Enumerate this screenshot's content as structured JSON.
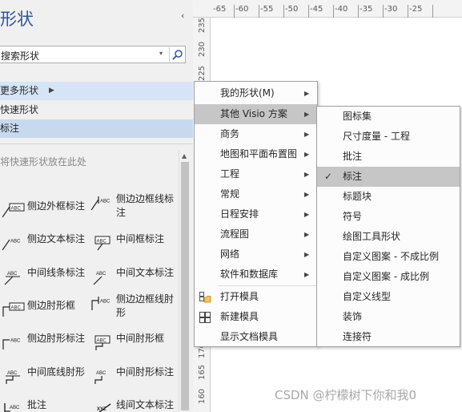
{
  "pane": {
    "title": "形状",
    "collapse_icon": "‹",
    "search_value": "搜索形状",
    "search_dropdown_icon": "▾",
    "more_shapes": "更多形状",
    "more_shapes_arrow": "▶",
    "quick_shapes": "快速形状",
    "current_stencil": "标注",
    "drop_hint": "将快速形状放在此处",
    "scroll_up_icon": "▲",
    "stencil_items": [
      {
        "label": "侧边外框标注"
      },
      {
        "label": "侧边边框线标注"
      },
      {
        "label": "侧边文本标注"
      },
      {
        "label": "中间框标注"
      },
      {
        "label": "中间线条标注"
      },
      {
        "label": "中间文本标注"
      },
      {
        "label": "侧边肘形框"
      },
      {
        "label": "侧边边框线肘形"
      },
      {
        "label": "侧边肘形标注"
      },
      {
        "label": "中间肘形框"
      },
      {
        "label": "中间底线肘形"
      },
      {
        "label": "中间肘形标注"
      },
      {
        "label": "批注"
      },
      {
        "label": "线间文本标注"
      }
    ],
    "icon_texts": {
      "abc": "ABC",
      "xyz": "XYZ"
    }
  },
  "ruler": {
    "top_labels": [
      "-65",
      "-60",
      "-55",
      "-50",
      "-45",
      "-40",
      "-35",
      "-30",
      "-25"
    ],
    "side_labels": [
      "235",
      "230",
      "225",
      "170",
      "165",
      "160"
    ]
  },
  "menu_primary": {
    "items": [
      {
        "label": "我的形状(M)",
        "has_submenu": true
      },
      {
        "label": "其他 Visio 方案",
        "has_submenu": true,
        "selected": true
      },
      {
        "label": "商务",
        "has_submenu": true
      },
      {
        "label": "地图和平面布置图",
        "has_submenu": true
      },
      {
        "label": "工程",
        "has_submenu": true
      },
      {
        "label": "常规",
        "has_submenu": true
      },
      {
        "label": "日程安排",
        "has_submenu": true
      },
      {
        "label": "流程图",
        "has_submenu": true
      },
      {
        "label": "网络",
        "has_submenu": true
      },
      {
        "label": "软件和数据库",
        "has_submenu": true
      }
    ],
    "actions": [
      {
        "label": "打开模具",
        "icon": "open-stencil-icon"
      },
      {
        "label": "新建模具",
        "icon": "new-stencil-icon"
      },
      {
        "label": "显示文档模具",
        "icon": ""
      }
    ],
    "arrow_glyph": "▶"
  },
  "menu_secondary": {
    "items": [
      {
        "label": "图标集"
      },
      {
        "label": "尺寸度量 - 工程"
      },
      {
        "label": "批注"
      },
      {
        "label": "标注",
        "checked": true
      },
      {
        "label": "标题块"
      },
      {
        "label": "符号"
      },
      {
        "label": "绘图工具形状"
      },
      {
        "label": "自定义图案 - 不成比例"
      },
      {
        "label": "自定义图案 - 成比例"
      },
      {
        "label": "自定义线型"
      },
      {
        "label": "装饰"
      },
      {
        "label": "连接符"
      }
    ],
    "check_glyph": "✓"
  },
  "watermark": "CSDN @柠檬树下你和我0",
  "colors": {
    "pane_bg": "#f0f0f0",
    "hover_blue": "#d6e5f5",
    "selected_blue": "#c7d9ef",
    "title_blue": "#2b579a",
    "menu_selected": "#c6c6c6"
  }
}
